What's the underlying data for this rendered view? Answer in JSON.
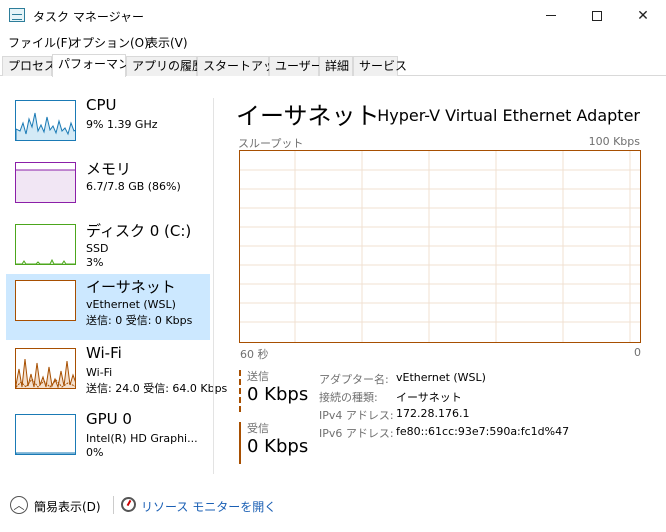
{
  "window": {
    "title": "タスク マネージャー"
  },
  "menu": [
    "ファイル(F)",
    "オプション(O)",
    "表示(V)"
  ],
  "tabs": [
    "プロセス",
    "パフォーマンス",
    "アプリの履歴",
    "スタートアップ",
    "ユーザー",
    "詳細",
    "サービス"
  ],
  "active_tab": "パフォーマンス",
  "sidebar": {
    "items": [
      {
        "name": "CPU",
        "line1": "9%  1.39 GHz",
        "line2": "",
        "color": "#1a7ab5"
      },
      {
        "name": "メモリ",
        "line1": "6.7/7.8 GB (86%)",
        "line2": "",
        "color": "#8b1fa8"
      },
      {
        "name": "ディスク 0 (C:)",
        "line1": "SSD",
        "line2": "3%",
        "color": "#4ca61d"
      },
      {
        "name": "イーサネット",
        "line1": "vEthernet (WSL)",
        "line2": "送信: 0 受信: 0 Kbps",
        "color": "#a74f01"
      },
      {
        "name": "Wi-Fi",
        "line1": "Wi-Fi",
        "line2": "送信: 24.0 受信: 64.0 Kbps",
        "color": "#a74f01"
      },
      {
        "name": "GPU 0",
        "line1": "Intel(R) HD Graphi...",
        "line2": "0%",
        "color": "#1a7ab5"
      }
    ]
  },
  "main": {
    "title": "イーサネット",
    "adapter": "Hyper-V Virtual Ethernet Adapter",
    "graph_label": "スループット",
    "graph_max": "100 Kbps",
    "time_span": "60 秒",
    "time_end": "0",
    "send_label": "送信",
    "send_value": "0 Kbps",
    "recv_label": "受信",
    "recv_value": "0 Kbps",
    "properties": [
      {
        "key": "アダプター名:",
        "value": "vEthernet (WSL)"
      },
      {
        "key": "接続の種類:",
        "value": "イーサネット"
      },
      {
        "key": "IPv4 アドレス:",
        "value": "172.28.176.1"
      },
      {
        "key": "IPv6 アドレス:",
        "value": "fe80::61cc:93e7:590a:fc1d%47"
      }
    ]
  },
  "footer": {
    "fewer_details": "簡易表示(D)",
    "resource_monitor": "リソース モニターを開く"
  }
}
